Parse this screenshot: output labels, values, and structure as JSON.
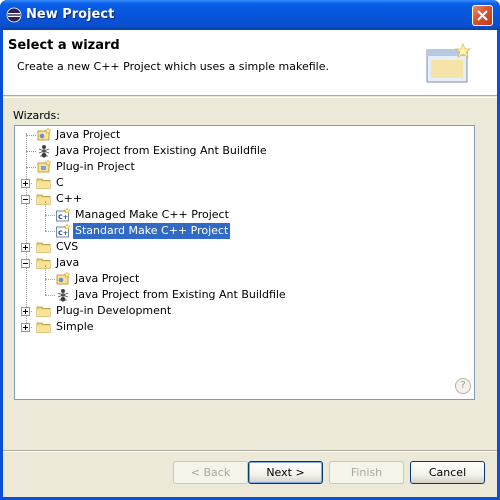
{
  "window": {
    "title": "New Project"
  },
  "banner": {
    "title": "Select a wizard",
    "description": "Create a new C++ Project which uses a simple makefile."
  },
  "wizards_label": "Wizards:",
  "tree": [
    {
      "label": "Java Project",
      "icon": "java-project-icon",
      "level": 0,
      "type": "item"
    },
    {
      "label": "Java Project from Existing Ant Buildfile",
      "icon": "ant-icon",
      "level": 0,
      "type": "item"
    },
    {
      "label": "Plug-in Project",
      "icon": "plugin-project-icon",
      "level": 0,
      "type": "item"
    },
    {
      "label": "C",
      "icon": "folder-icon",
      "level": 0,
      "type": "folder",
      "expanded": false
    },
    {
      "label": "C++",
      "icon": "folder-icon",
      "level": 0,
      "type": "folder",
      "expanded": true
    },
    {
      "label": "Managed Make C++ Project",
      "icon": "cpp-project-icon",
      "level": 1,
      "type": "item"
    },
    {
      "label": "Standard Make C++ Project",
      "icon": "cpp-project-icon",
      "level": 1,
      "type": "item",
      "selected": true
    },
    {
      "label": "CVS",
      "icon": "folder-icon",
      "level": 0,
      "type": "folder",
      "expanded": false
    },
    {
      "label": "Java",
      "icon": "folder-icon",
      "level": 0,
      "type": "folder",
      "expanded": true
    },
    {
      "label": "Java Project",
      "icon": "java-project-icon",
      "level": 1,
      "type": "item"
    },
    {
      "label": "Java Project from Existing Ant Buildfile",
      "icon": "ant-icon",
      "level": 1,
      "type": "item"
    },
    {
      "label": "Plug-in Development",
      "icon": "folder-icon",
      "level": 0,
      "type": "folder",
      "expanded": false
    },
    {
      "label": "Simple",
      "icon": "folder-icon",
      "level": 0,
      "type": "folder",
      "expanded": false
    }
  ],
  "buttons": {
    "back": "< Back",
    "next": "Next >",
    "finish": "Finish",
    "cancel": "Cancel"
  },
  "help": "?",
  "colors": {
    "selection": "#316ac5",
    "titlebar": "#0654d8",
    "dialog_bg": "#ece9d8"
  }
}
